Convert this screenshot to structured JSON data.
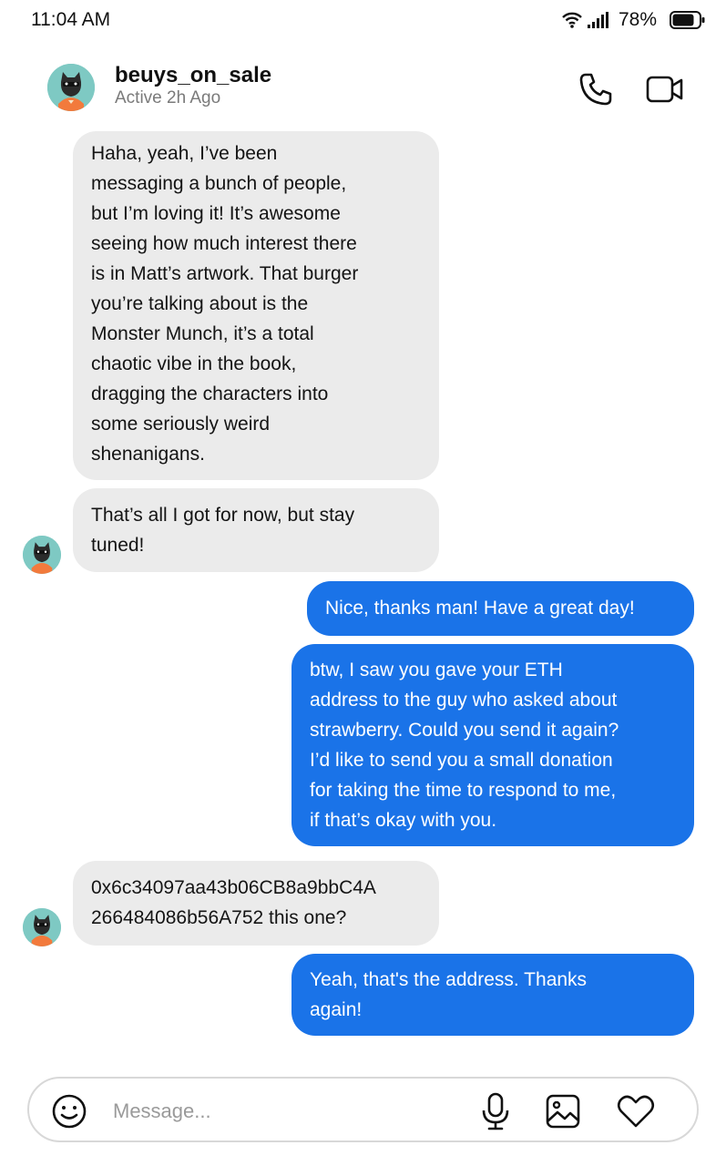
{
  "status_bar": {
    "time": "11:04 AM",
    "battery": "78%"
  },
  "header": {
    "contact_name": "beuys_on_sale",
    "contact_status": "Active 2h Ago"
  },
  "messages": [
    {
      "direction": "incoming",
      "lines": [
        "Haha, yeah, I’ve been",
        "messaging a bunch of people,",
        "but I’m loving it! It’s awesome",
        "seeing how much interest there",
        "is in Matt’s artwork. That burger",
        "you’re talking about is the",
        "Monster Munch, it’s a total",
        "chaotic vibe in the book,",
        "dragging the characters into",
        "some seriously weird",
        "shenanigans."
      ]
    },
    {
      "direction": "incoming",
      "lines": [
        "That’s all I got for now, but stay",
        "tuned!"
      ]
    },
    {
      "direction": "outgoing",
      "lines": [
        "Nice, thanks man! Have a great day!"
      ]
    },
    {
      "direction": "outgoing",
      "lines": [
        "btw, I saw you gave your ETH",
        "address to the guy who asked about",
        "strawberry. Could you send it again?",
        "I’d like to send you a small donation",
        "for taking the time to respond to me,",
        "if that’s okay with you."
      ]
    },
    {
      "direction": "incoming",
      "lines": [
        "0x6c34097aa43b06CB8a9bbC4A",
        "266484086b56A752 this one?"
      ]
    },
    {
      "direction": "outgoing",
      "lines": [
        "Yeah, that's the address. Thanks",
        "again!"
      ]
    }
  ],
  "composer": {
    "placeholder": "Message..."
  },
  "icons": {
    "wifi": "wifi-icon",
    "signal": "signal-icon",
    "battery": "battery-icon",
    "call": "phone-icon",
    "video": "video-camera-icon",
    "emoji": "smiley-icon",
    "mic": "microphone-icon",
    "gallery": "image-icon",
    "like": "heart-icon"
  },
  "colors": {
    "outgoing_bubble": "#1a73e8",
    "incoming_bubble": "#ebebeb",
    "avatar_bg": "#7ec9c3"
  }
}
